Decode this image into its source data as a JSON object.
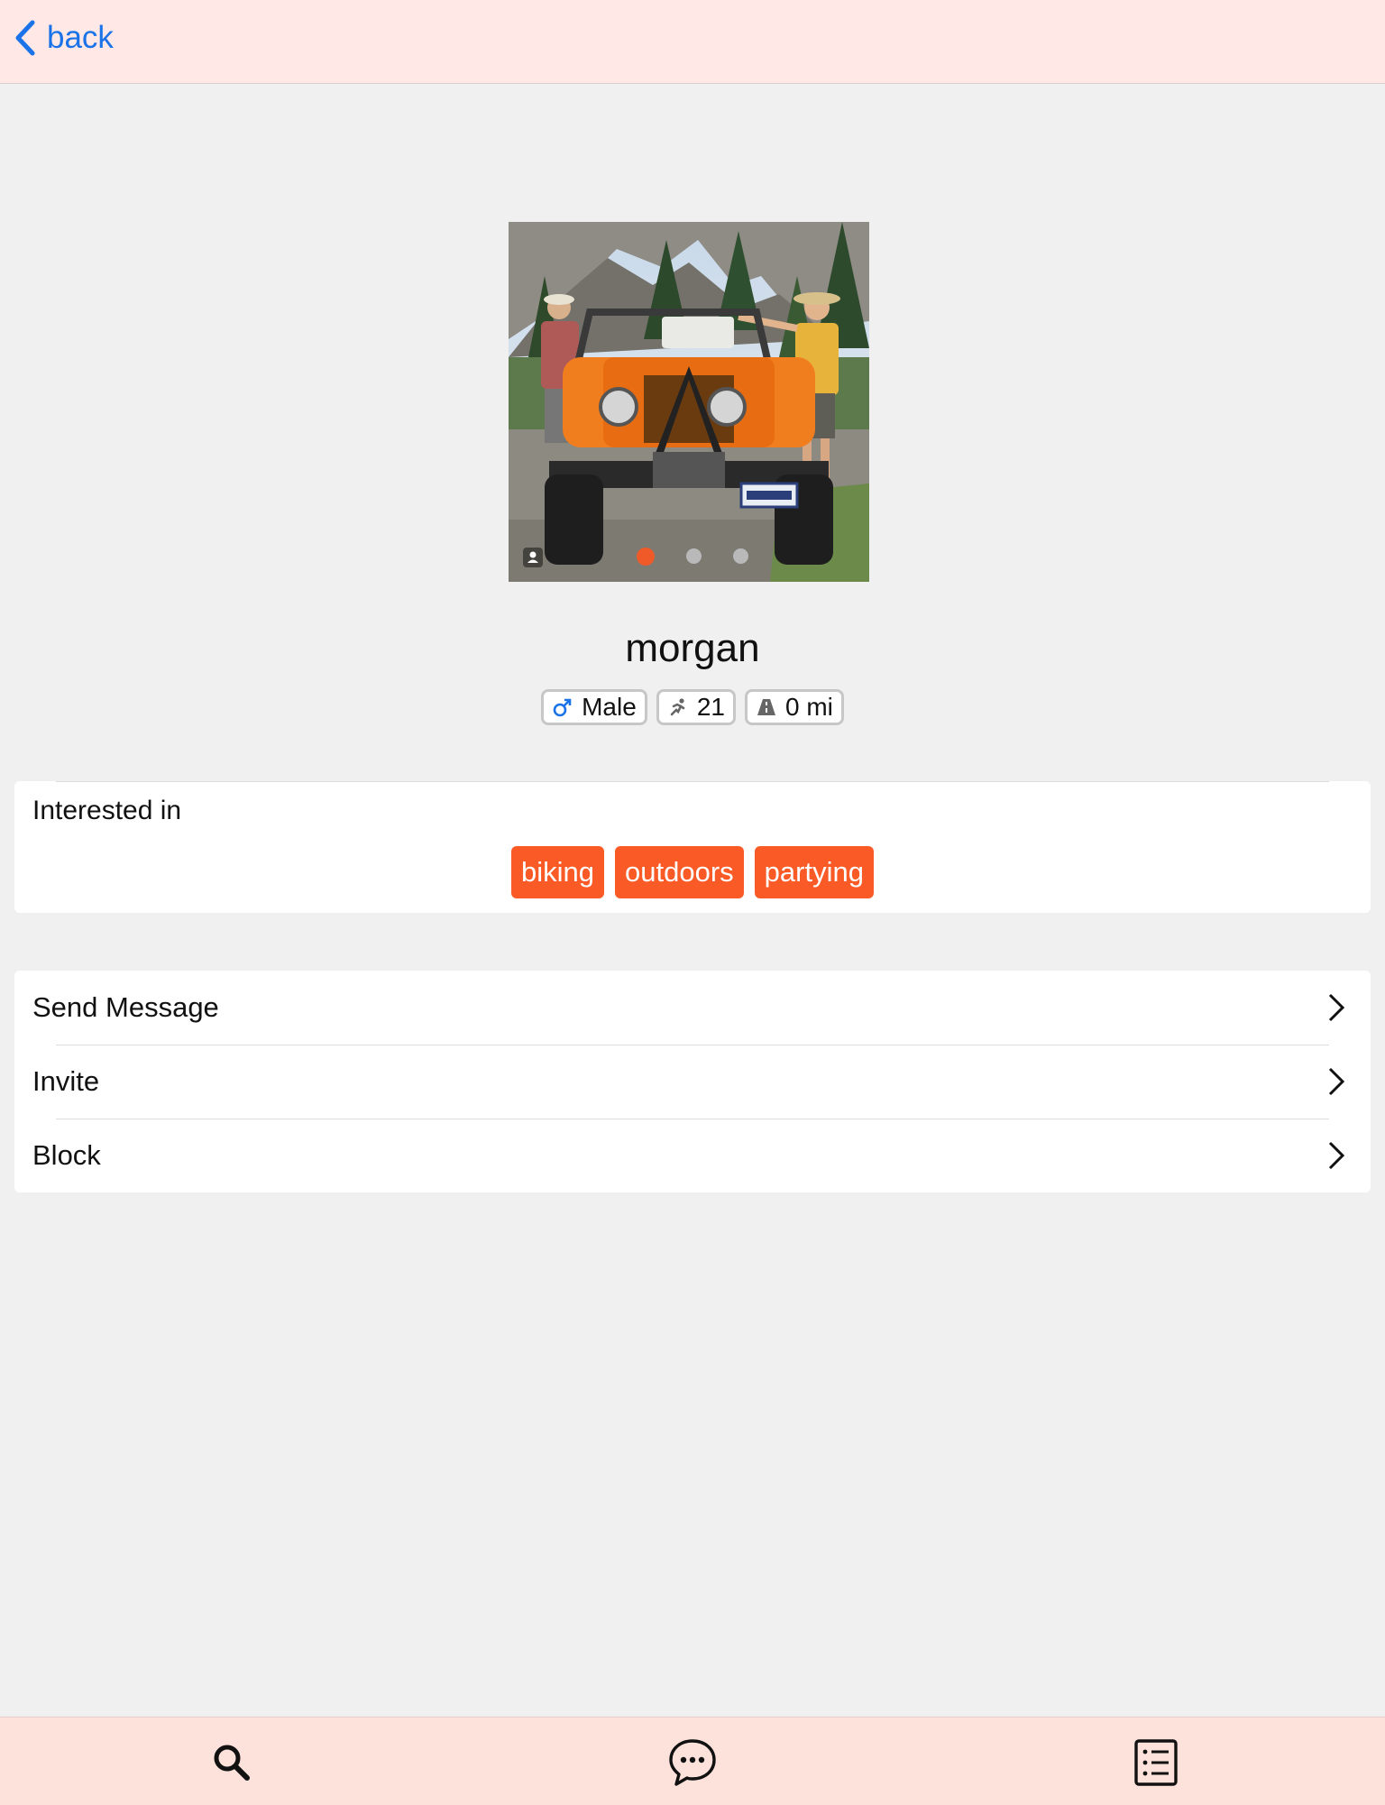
{
  "nav": {
    "back_label": "back",
    "accent_color": "#1a73e8",
    "bar_color": "#ffe8e6"
  },
  "profile": {
    "name": "morgan",
    "photo_count": 3,
    "active_photo_index": 0,
    "chips": [
      {
        "icon": "male-icon",
        "label": "Male"
      },
      {
        "icon": "running-icon",
        "label": "21"
      },
      {
        "icon": "road-icon",
        "label": "0 mi"
      }
    ]
  },
  "interests": {
    "title": "Interested in",
    "tag_color": "#fa5a25",
    "tags": [
      "biking",
      "outdoors",
      "partying"
    ]
  },
  "actions": [
    {
      "label": "Send Message"
    },
    {
      "label": "Invite"
    },
    {
      "label": "Block"
    }
  ],
  "tab_bar": {
    "tabs": [
      {
        "icon": "search-icon"
      },
      {
        "icon": "chat-icon"
      },
      {
        "icon": "list-icon"
      }
    ]
  }
}
